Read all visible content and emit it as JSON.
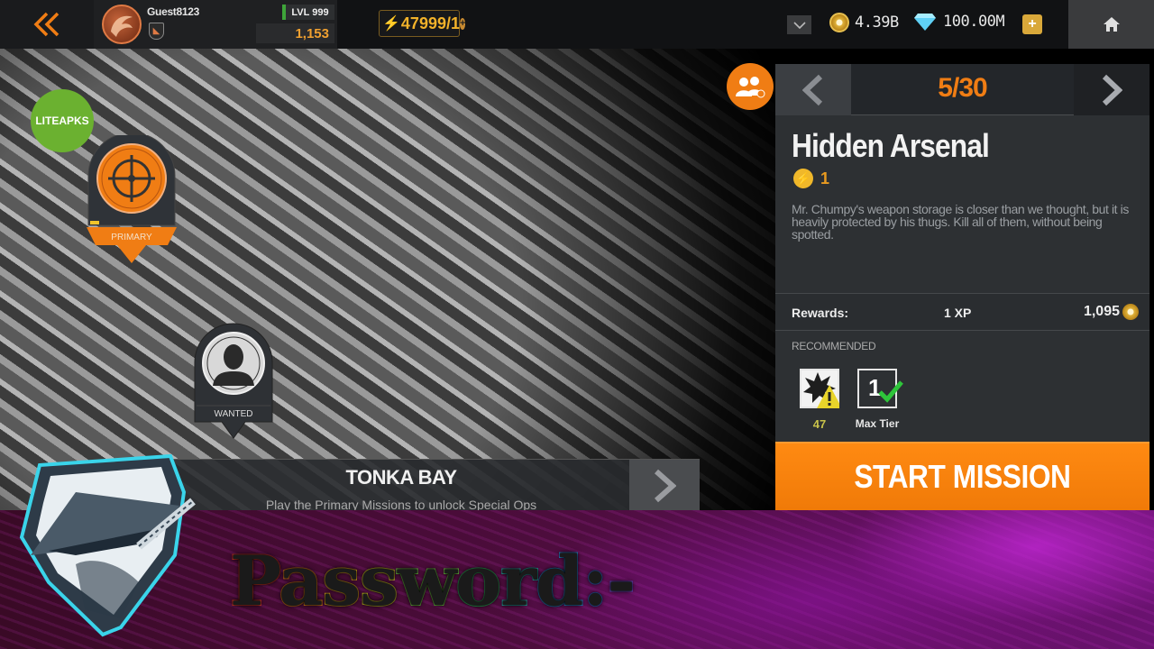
{
  "topbar": {
    "back_icon": "double-chevron-left-icon",
    "player": {
      "name": "Guest8123",
      "level_label": "LVL 999",
      "xp": "1,153"
    },
    "energy": "47999/1",
    "coins": "4.39B",
    "gems": "100.00M",
    "add_label": "+"
  },
  "map": {
    "watermark": "LITEAPKS",
    "pins": [
      {
        "label": "PRIMARY",
        "icon": "crosshair-icon"
      },
      {
        "label": "WANTED",
        "icon": "person-silhouette-icon"
      }
    ],
    "region": {
      "title": "TONKA BAY",
      "subtitle": "Play the Primary Missions to unlock Special Ops"
    }
  },
  "mission": {
    "pager": "5/30",
    "title": "Hidden Arsenal",
    "energy_cost": "1",
    "description": "Mr. Chumpy's weapon storage is closer than we thought, but it is heavily protected by his thugs. Kill all of them, without being spotted.",
    "rewards": {
      "label": "Rewards:",
      "xp": "1 XP",
      "coins": "1,095"
    },
    "recommended": {
      "label": "RECOMMENDED",
      "items": [
        {
          "icon": "explosion-warning-icon",
          "value": "47",
          "color": "#c8c24a"
        },
        {
          "icon": "tier-check-icon",
          "tier": "1",
          "value": "Max Tier",
          "color": "#e6e6e6"
        }
      ]
    },
    "start_label": "START MISSION"
  },
  "overlay": {
    "password_label": "Password:-",
    "password_colors": [
      "#e8412a",
      "#f08a1c",
      "#f2b823",
      "#e6e02a",
      "#78d84a",
      "#3ac86a",
      "#2ab8b0",
      "#2a9ae0",
      "#3a7ae0",
      "#6a5ae0"
    ]
  },
  "colors": {
    "accent": "#f07d14",
    "panel": "#2d3033",
    "start_button": "#f5800c"
  }
}
